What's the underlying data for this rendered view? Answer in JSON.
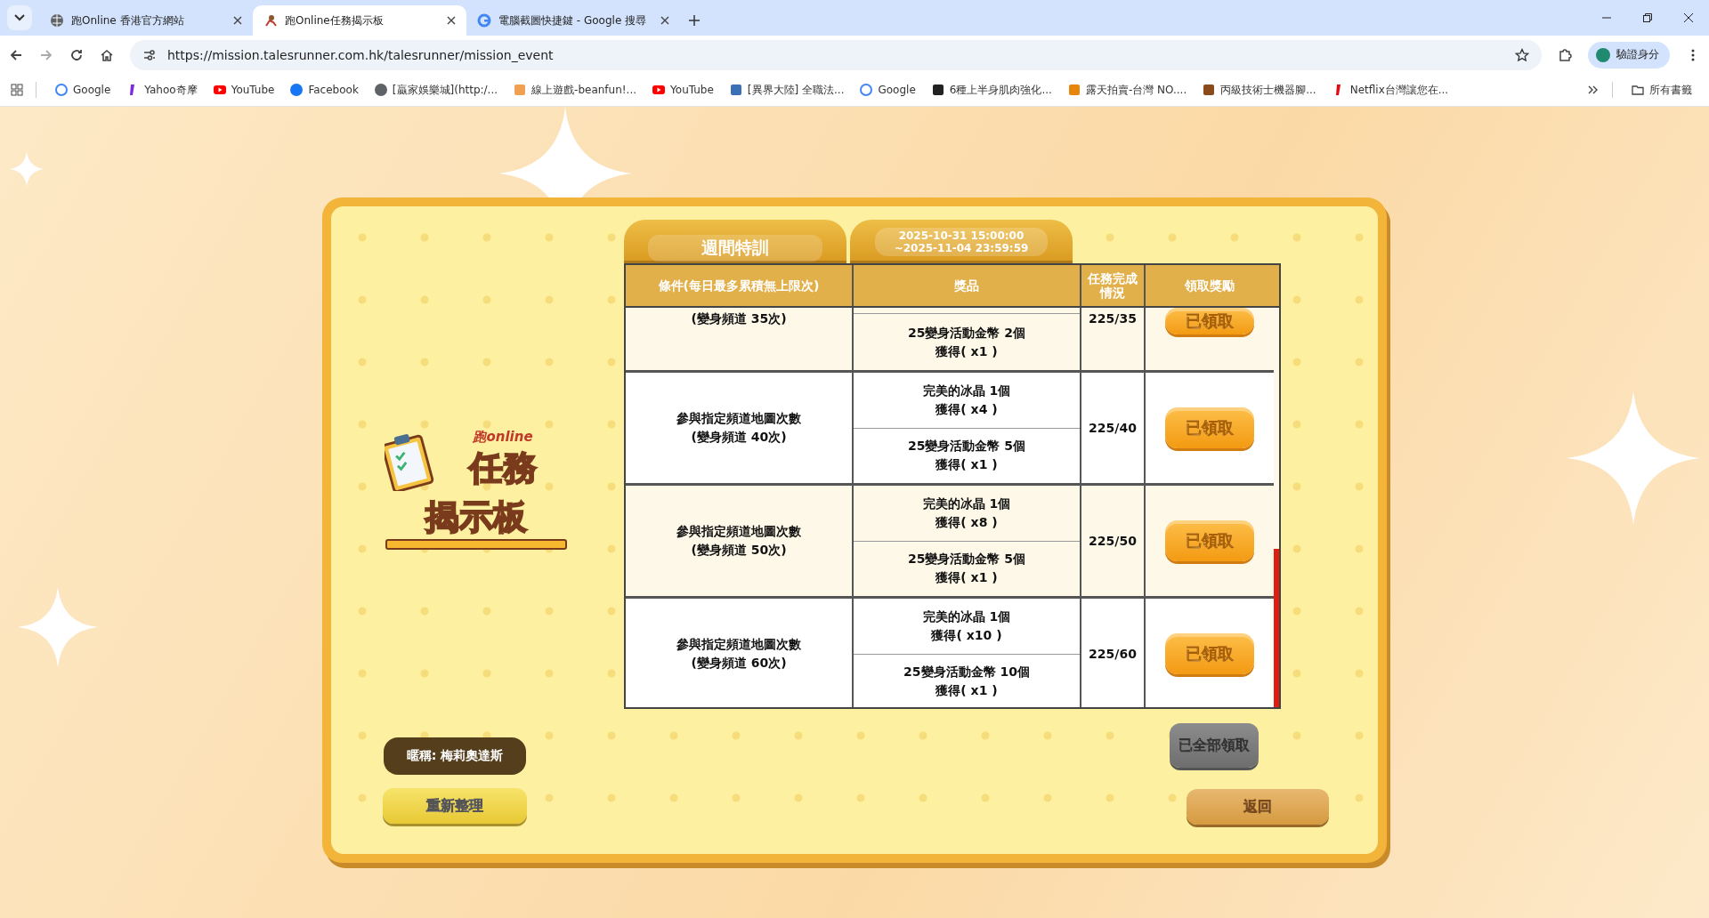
{
  "browser": {
    "tabs": [
      {
        "title": "跑Online 香港官方網站",
        "selected": false,
        "kind": "globe"
      },
      {
        "title": "跑Online任務揭示板",
        "selected": true,
        "kind": "racer"
      },
      {
        "title": "電腦截圖快捷鍵 - Google 搜尋",
        "selected": false,
        "kind": "google"
      }
    ],
    "url": "https://mission.talesrunner.com.hk/talesrunner/mission_event",
    "profile_label": "驗證身分",
    "bookmarks": [
      {
        "label": "Google",
        "kind": "google"
      },
      {
        "label": "Yahoo奇摩",
        "kind": "yahoo"
      },
      {
        "label": "YouTube",
        "kind": "youtube"
      },
      {
        "label": "Facebook",
        "kind": "facebook"
      },
      {
        "label": "[贏家娛樂城](http:/...",
        "kind": "globe"
      },
      {
        "label": "線上遊戲-beanfun!...",
        "kind": "bean"
      },
      {
        "label": "YouTube",
        "kind": "youtube"
      },
      {
        "label": "[異界大陸] 全職法...",
        "kind": "crown"
      },
      {
        "label": "Google",
        "kind": "google"
      },
      {
        "label": "6種上半身肌肉強化...",
        "kind": "mf"
      },
      {
        "label": "露天拍賣-台灣 NO....",
        "kind": "ruten"
      },
      {
        "label": "丙級技術士機器腳...",
        "kind": "book"
      },
      {
        "label": "Netflix台灣讓您在...",
        "kind": "netflix"
      }
    ],
    "all_bookmarks": "所有書籤"
  },
  "board": {
    "logo": {
      "brand": "跑online",
      "title_lines": [
        "任務",
        "揭示板"
      ]
    },
    "nickname": "暱稱: 梅莉奧達斯",
    "refresh_button": "重新整理",
    "title_tab": "週間特訓",
    "period": "2025-10-31 15:00:00\n~2025-11-04 23:59:59",
    "table": {
      "columns": [
        "條件(每日最多累積無上限次)",
        "獎品",
        "任務完成情況",
        "領取獎勵"
      ],
      "rows": [
        {
          "clipped": true,
          "condition": "(變身頻道 35次)",
          "prizes": [
            [
              "25變身活動金幣 2個",
              "獲得( x1 )"
            ]
          ],
          "progress": "225/35",
          "claim": "已領取"
        },
        {
          "clipped": false,
          "condition": "參與指定頻道地圖次數\n(變身頻道 40次)",
          "prizes": [
            [
              "完美的冰晶 1個",
              "獲得( x4 )"
            ],
            [
              "25變身活動金幣 5個",
              "獲得( x1 )"
            ]
          ],
          "progress": "225/40",
          "claim": "已領取"
        },
        {
          "clipped": false,
          "condition": "參與指定頻道地圖次數\n(變身頻道 50次)",
          "prizes": [
            [
              "完美的冰晶 1個",
              "獲得( x8 )"
            ],
            [
              "25變身活動金幣 5個",
              "獲得( x1 )"
            ]
          ],
          "progress": "225/50",
          "claim": "已領取"
        },
        {
          "clipped": false,
          "condition": "參與指定頻道地圖次數\n(變身頻道 60次)",
          "prizes": [
            [
              "完美的冰晶 1個",
              "獲得( x10 )"
            ],
            [
              "25變身活動金幣 10個",
              "獲得( x1 )"
            ]
          ],
          "progress": "225/60",
          "claim": "已領取"
        }
      ]
    },
    "claim_all": {
      "label": "已全部領取",
      "disabled": true
    },
    "back_button": "返回"
  }
}
